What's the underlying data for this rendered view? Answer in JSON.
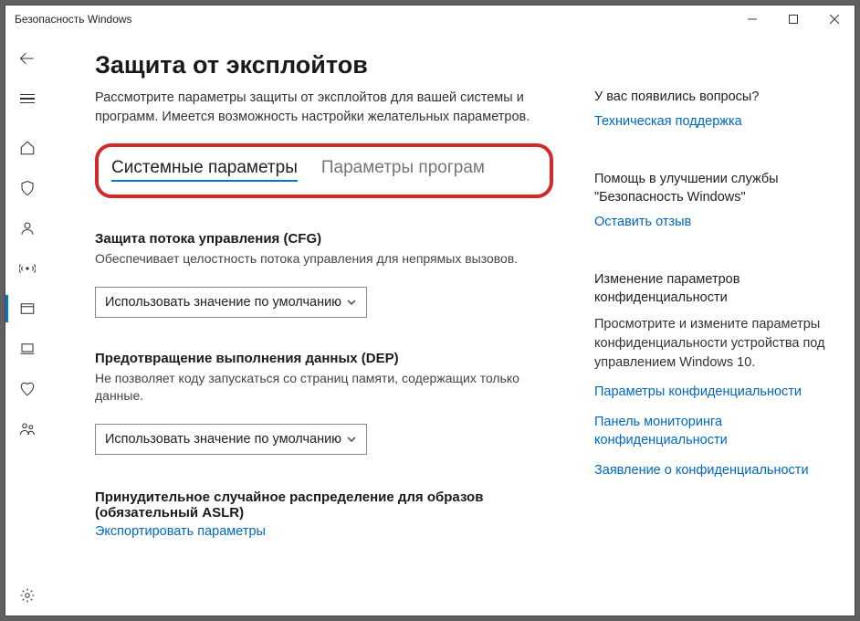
{
  "window": {
    "title": "Безопасность Windows"
  },
  "page": {
    "title": "Защита от эксплойтов",
    "description": "Рассмотрите параметры защиты от эксплойтов для вашей системы и программ. Имеется возможность настройки желательных параметров."
  },
  "tabs": {
    "system": "Системные параметры",
    "program": "Параметры програм"
  },
  "settings": {
    "cfg": {
      "title": "Защита потока управления (CFG)",
      "desc": "Обеспечивает целостность потока управления для непрямых вызовов.",
      "value": "Использовать значение по умолчанию"
    },
    "dep": {
      "title": "Предотвращение выполнения данных (DEP)",
      "desc": "Не позволяет коду запускаться со страниц памяти, содержащих только данные.",
      "value": "Использовать значение по умолчанию"
    },
    "aslr": {
      "title": "Принудительное случайное распределение для образов",
      "sub": "(обязательный ASLR)"
    }
  },
  "export_link": "Экспортировать параметры",
  "aside": {
    "questions": {
      "heading": "У вас появились вопросы?",
      "link": "Техническая поддержка"
    },
    "feedback": {
      "heading": "Помощь в улучшении службы \"Безопасность Windows\"",
      "link": "Оставить отзыв"
    },
    "privacy": {
      "heading": "Изменение параметров конфиденциальности",
      "text": "Просмотрите и измените параметры конфиденциальности устройства под управлением Windows 10.",
      "link1": "Параметры конфиденциальности",
      "link2": "Панель мониторинга конфиденциальности",
      "link3": "Заявление о конфиденциальности"
    }
  }
}
